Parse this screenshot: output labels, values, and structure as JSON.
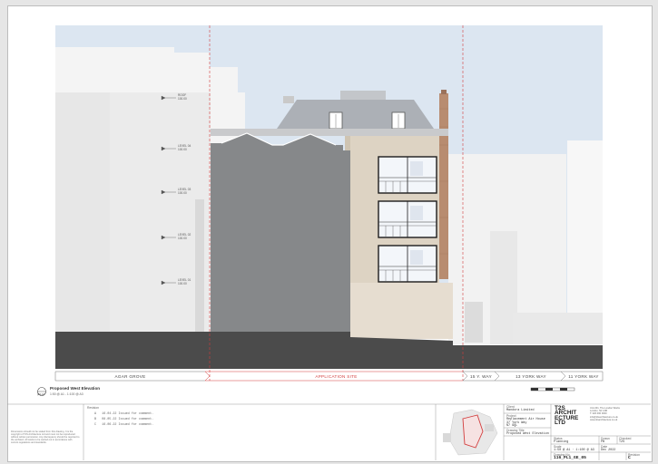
{
  "drawing": {
    "title": "Proposed West Elevation",
    "scale_note": "1:50 @ A1 - 1:100 @ A3",
    "ref": "(01-A)"
  },
  "levels": [
    {
      "name": "ROOF",
      "value": "100.00"
    },
    {
      "name": "LEVEL 04",
      "value": "100.00"
    },
    {
      "name": "LEVEL 03",
      "value": "100.00"
    },
    {
      "name": "LEVEL 02",
      "value": "100.00"
    },
    {
      "name": "LEVEL 01",
      "value": "100.00"
    }
  ],
  "strip_labels": {
    "agar_grove": "AGAR GROVE",
    "application_site": "APPLICATION SITE",
    "y_way_15": "15 Y. WAY",
    "york_way_13": "13 YORK WAY",
    "york_way_11": "11 YORK WAY"
  },
  "revisions": {
    "header": "Revision",
    "rows": [
      {
        "rev": "A",
        "date": "16.04.22",
        "desc": "Issued for comment."
      },
      {
        "rev": "B",
        "date": "08.05.22",
        "desc": "Issued for comment."
      },
      {
        "rev": "C",
        "date": "16.06.22",
        "desc": "Issued for comment."
      }
    ]
  },
  "copyright_note": "Dimensions should not be scaled from this drawing. It is the copyright of T2S Architecture Ltd and must not be reproduced without written permission. Any discrepancy should be reported to the architect. All works to be carried out in accordance with current regulations and standards.",
  "title_block": {
    "client_label": "Client",
    "client": "Mandora Limited",
    "project_label": "Project",
    "project": [
      "Replacement Air House",
      "37 York Way",
      "N7 9QL"
    ],
    "drawing_label": "Drawing Title",
    "drawing_title": "Proposed West Elevation",
    "status_label": "Status",
    "status": "Planning",
    "scale_label": "Scale",
    "scale": "1:50 @ A1 · 1:100 @ A3",
    "drawn_label": "Drawn",
    "drawn": "PB",
    "checked_label": "Checked",
    "checked": "T2S",
    "date_label": "Date",
    "date": "Dec 2022",
    "dwg_label": "Drawing No.",
    "dwg_no": "116_PL1_GE_05",
    "rev_label": "Revision",
    "rev": "C"
  },
  "firm": {
    "logo_lines": [
      "T2S",
      "ARCHIT",
      "ECTURE",
      "LTD"
    ],
    "address": [
      "Unit 201, The London Works",
      "London, N1 1AB",
      "T: 020 000 0000",
      "info@t2sarchitecture.co.uk",
      "www.t2sarchitecture.co.uk"
    ]
  },
  "colors": {
    "sky": "#dce6f1",
    "neighbour": "#e5e5e5",
    "party_wall": "#86888a",
    "facade": "#ddd3c3",
    "roof": "#acb0b6",
    "ground": "#4b4b4b",
    "site_line": "#d23c3c"
  }
}
